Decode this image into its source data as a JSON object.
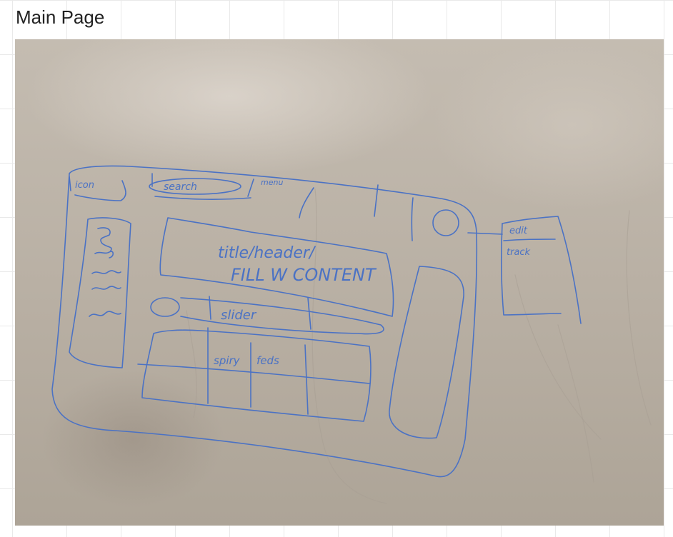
{
  "frame": {
    "title": "Main Page"
  },
  "sketch": {
    "header": {
      "icon_label": "icon",
      "search_label": "search",
      "menu_label": "menu"
    },
    "hero": {
      "line1": "title/header/",
      "line2": "FILL W CONTENT"
    },
    "slider_label": "slider",
    "tabs": {
      "left": "spiry",
      "right": "feds"
    },
    "side_panel": {
      "item1": "edit",
      "item2": "track"
    }
  }
}
